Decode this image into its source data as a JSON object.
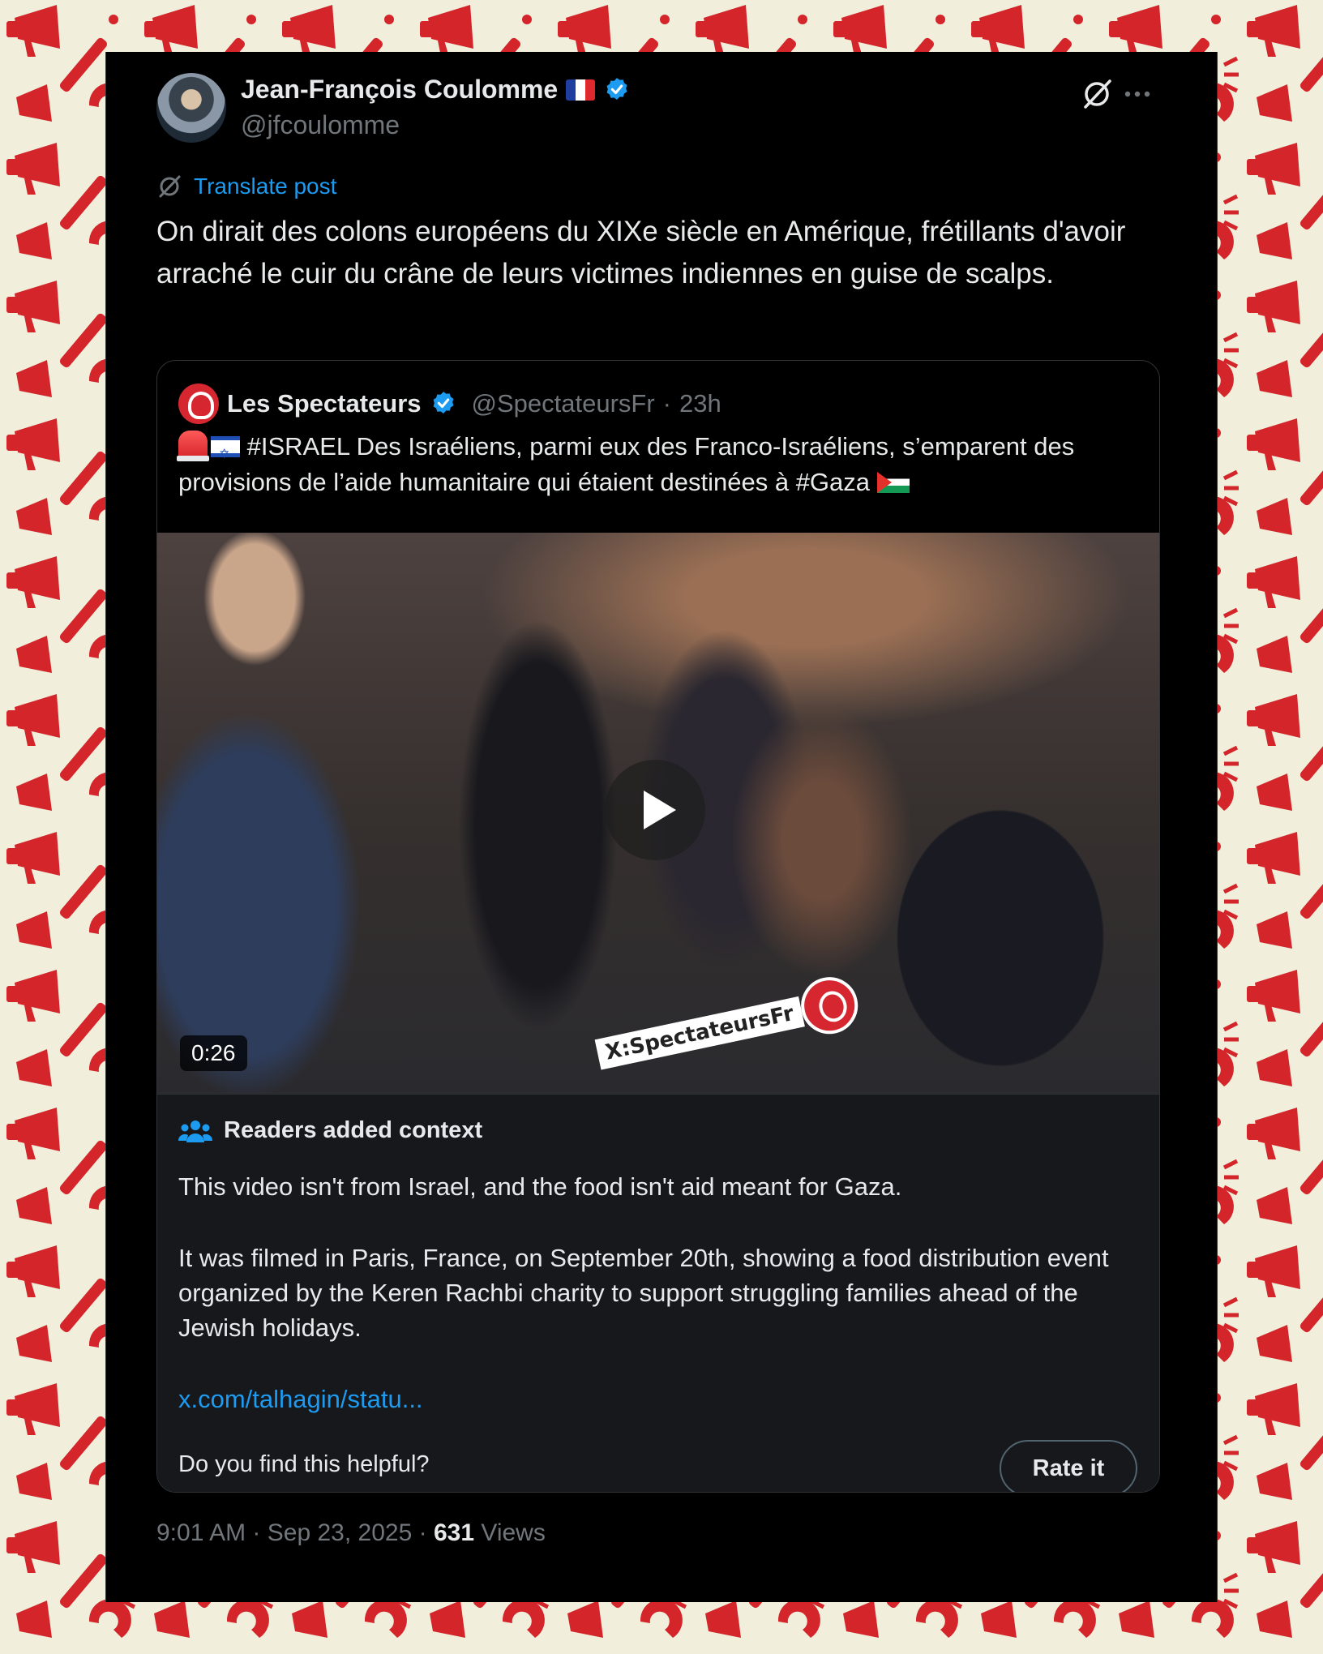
{
  "author": {
    "name": "Jean-François Coulomme",
    "handle": "@jfcoulomme"
  },
  "translate_label": "Translate post",
  "post_text": "On dirait des colons européens du XIXe siècle en Amérique, frétillants d'avoir arraché le cuir du crâne de leurs victimes indiennes en guise de scalps.",
  "quoted": {
    "name": "Les Spectateurs",
    "handle": "@SpectateursFr",
    "time_sep": "·",
    "time": "23h",
    "text_main": " #ISRAEL Des Israéliens, parmi eux des Franco-Israéliens, s’emparent des provisions de l’aide humanitaire qui étaient destinées à #Gaza ",
    "video": {
      "duration": "0:26",
      "watermark": "X:SpectateursFr"
    }
  },
  "context": {
    "title": "Readers added context",
    "paragraph1": "This video isn't from Israel, and the food isn't aid meant for Gaza.",
    "paragraph2": "It was filmed in Paris, France, on September 20th, showing a food distribution event organized by the Keren Rachbi charity to support struggling families ahead of the Jewish holidays.",
    "link": "x.com/talhagin/statu...",
    "question": "Do you find this helpful?",
    "rate_label": "Rate it"
  },
  "meta": {
    "time": "9:01 AM",
    "sep1": "·",
    "date": "Sep 23, 2025",
    "sep2": "·",
    "views_count": "631",
    "views_label": "Views"
  },
  "colors": {
    "background": "#f1efdc",
    "pattern": "#d4252b",
    "card": "#000000",
    "text": "#e7e9ea",
    "muted": "#71767b",
    "link": "#1d9bf0",
    "verified": "#1d9bf0"
  },
  "icons": [
    "verified-badge-icon",
    "flag-fr-icon",
    "grok-icon",
    "more-icon",
    "translate-icon",
    "siren-emoji-icon",
    "flag-israel-icon",
    "flag-palestine-icon",
    "play-icon",
    "community-notes-icon"
  ]
}
